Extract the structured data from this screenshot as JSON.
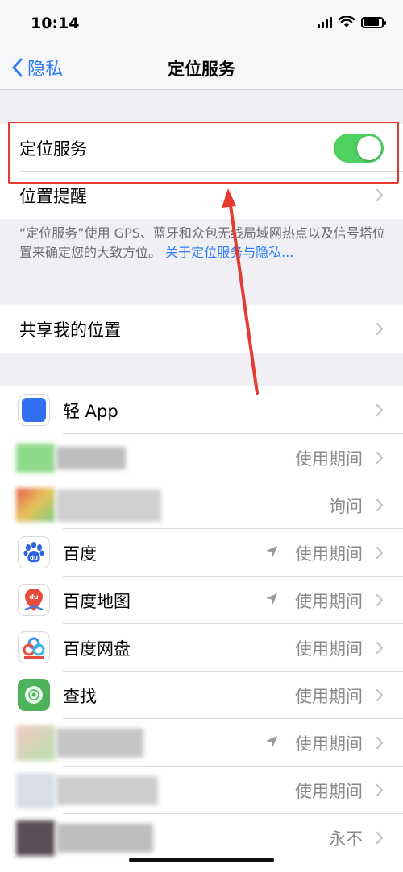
{
  "status_bar": {
    "time": "10:14"
  },
  "nav": {
    "back_label": "隐私",
    "title": "定位服务"
  },
  "location_services": {
    "label": "定位服务",
    "enabled": true
  },
  "location_alerts": {
    "label": "位置提醒"
  },
  "footnote": {
    "text": "“定位服务”使用 GPS、蓝牙和众包无线局域网热点以及信号塔位置来确定您的大致方位。",
    "link": "关于定位服务与隐私..."
  },
  "share_location": {
    "label": "共享我的位置"
  },
  "apps": [
    {
      "name": "轻 App",
      "status": ""
    },
    {
      "name": "",
      "status": "使用期间"
    },
    {
      "name": "",
      "status": "询问"
    },
    {
      "name": "百度",
      "status": "使用期间",
      "recent_use": true
    },
    {
      "name": "百度地图",
      "status": "使用期间",
      "recent_use": true
    },
    {
      "name": "百度网盘",
      "status": "使用期间"
    },
    {
      "name": "查找",
      "status": "使用期间"
    },
    {
      "name": "",
      "status": "使用期间",
      "recent_use": true
    },
    {
      "name": "",
      "status": "使用期间"
    },
    {
      "name": "",
      "status": "永不"
    }
  ],
  "colors": {
    "accent": "#2f7df6",
    "toggle_on": "#4fd161",
    "annotation_red": "#e53a2e"
  }
}
